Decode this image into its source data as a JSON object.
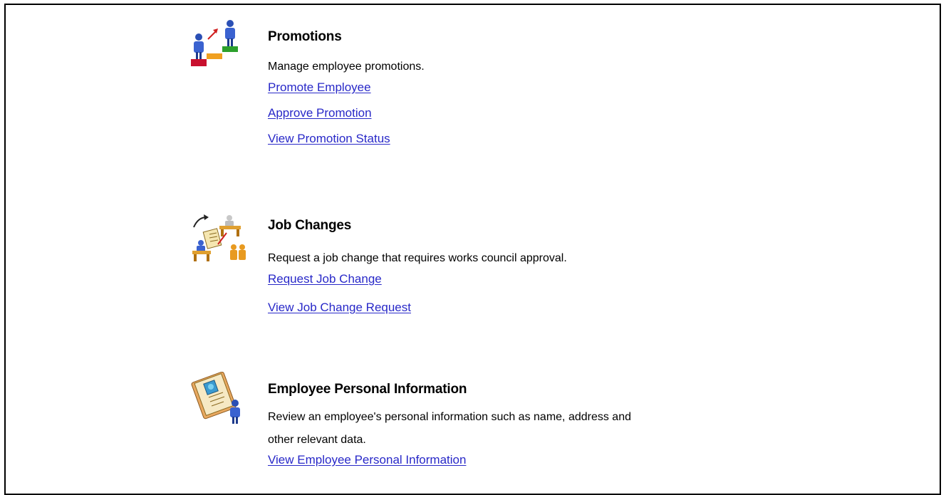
{
  "sections": [
    {
      "icon": "promotion-stairs-icon",
      "title": "Promotions",
      "description": "Manage employee promotions.",
      "links": [
        "Promote Employee",
        "Approve Promotion",
        "View Promotion Status"
      ]
    },
    {
      "icon": "job-change-desk-icon",
      "title": "Job Changes",
      "description": "Request a job change that requires works council approval.",
      "links": [
        "Request Job Change",
        "View Job Change Request"
      ]
    },
    {
      "icon": "personal-info-folder-icon",
      "title": "Employee Personal Information",
      "description_line1": "Review an employee's personal information such as name, address and",
      "description_line2": "other relevant data.",
      "links": [
        "View Employee Personal Information"
      ]
    }
  ],
  "colors": {
    "link": "#2828c8",
    "text": "#000000",
    "border": "#000000",
    "background": "#ffffff"
  }
}
